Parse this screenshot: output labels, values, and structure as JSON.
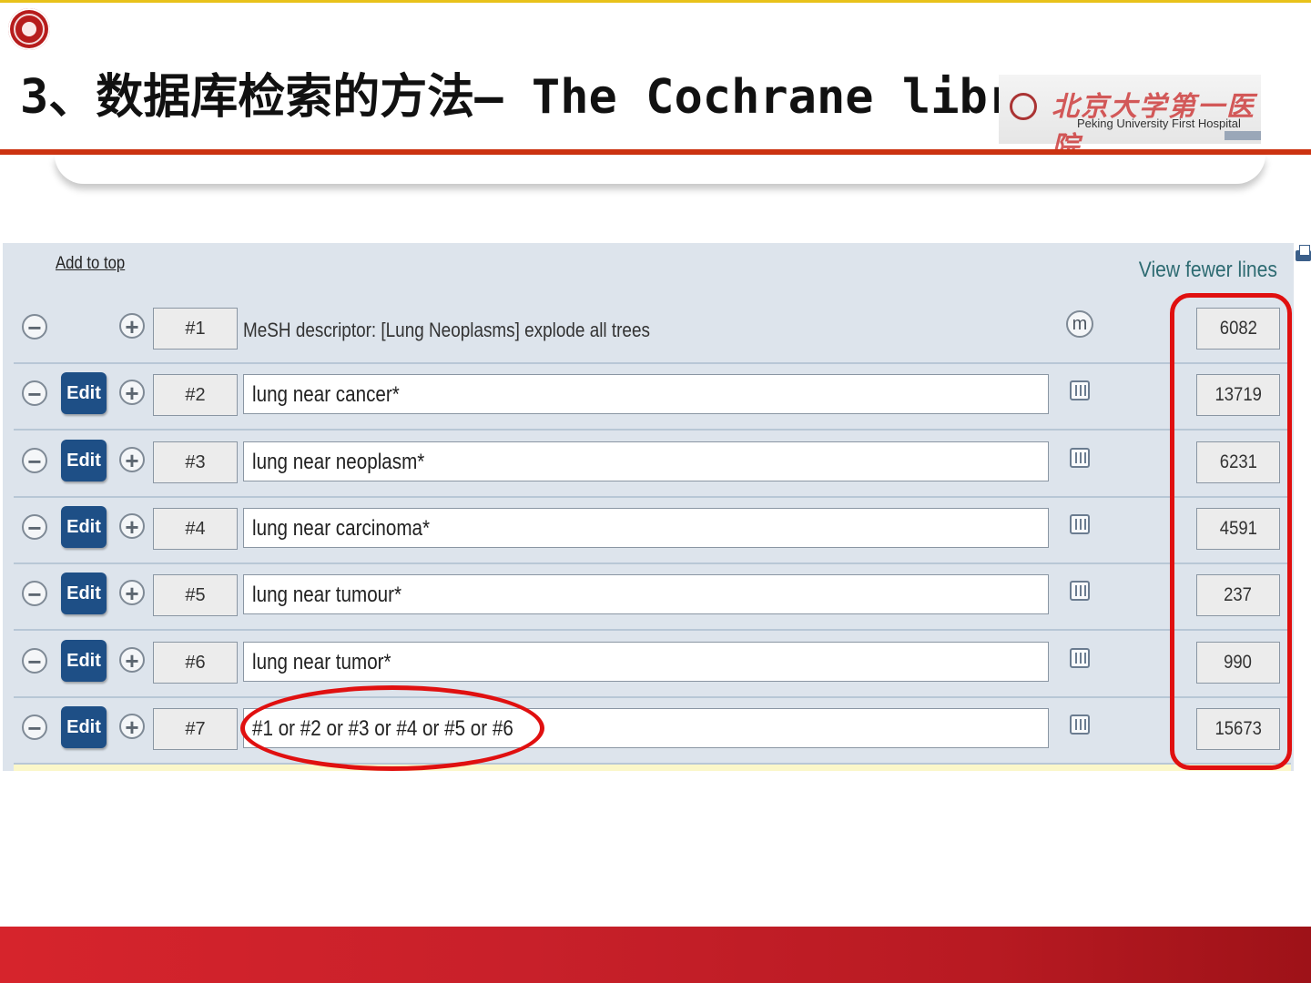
{
  "slide": {
    "title": "3、数据库检索的方法— The Cochrane library",
    "hospital_logo": {
      "cn": "北京大学第一医院",
      "en": "Peking University First Hospital"
    },
    "colors": {
      "rule": "#cc3311",
      "band": "#c8202a",
      "annotation": "#e01010"
    }
  },
  "panel": {
    "add_to_top": "Add to top",
    "view_fewer": "View fewer lines",
    "edit_label": "Edit",
    "rows": [
      {
        "num": "#1",
        "query": "MeSH descriptor: [Lung Neoplasms] explode all trees",
        "count": "6082",
        "type": "mesh"
      },
      {
        "num": "#2",
        "query": "lung near cancer*",
        "count": "13719",
        "type": "text"
      },
      {
        "num": "#3",
        "query": "lung near neoplasm*",
        "count": "6231",
        "type": "text"
      },
      {
        "num": "#4",
        "query": "lung near carcinoma*",
        "count": "4591",
        "type": "text"
      },
      {
        "num": "#5",
        "query": "lung near tumour*",
        "count": "237",
        "type": "text"
      },
      {
        "num": "#6",
        "query": "lung near tumor*",
        "count": "990",
        "type": "text"
      },
      {
        "num": "#7",
        "query": "#1 or #2 or #3 or #4 or #5 or #6",
        "count": "15673",
        "type": "text"
      }
    ]
  }
}
